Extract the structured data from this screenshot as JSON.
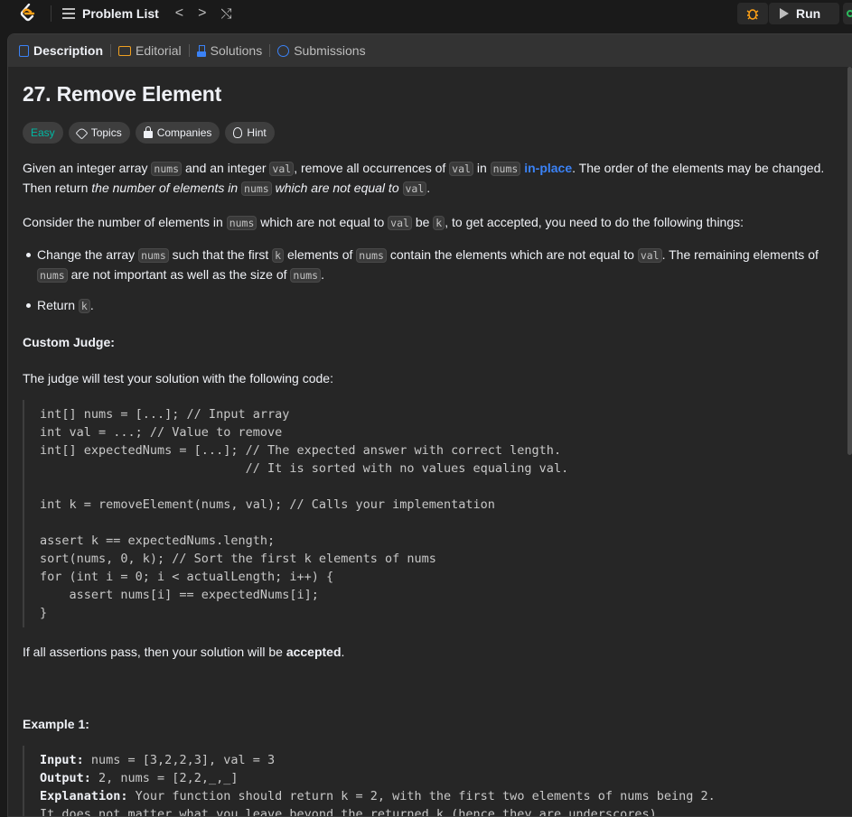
{
  "topbar": {
    "problem_list": "Problem List",
    "prev": "<",
    "next": ">",
    "shuffle": "⤭",
    "run": "Run"
  },
  "tabs": [
    {
      "label": "Description"
    },
    {
      "label": "Editorial"
    },
    {
      "label": "Solutions"
    },
    {
      "label": "Submissions"
    }
  ],
  "problem": {
    "title": "27. Remove Element",
    "badges": {
      "difficulty": "Easy",
      "topics": "Topics",
      "companies": "Companies",
      "hint": "Hint"
    },
    "p1": {
      "a": "Given an integer array ",
      "c1": "nums",
      "b": " and an integer ",
      "c2": "val",
      "c": ", remove all occurrences of ",
      "c3": "val",
      "d": " in ",
      "c4": "nums",
      "e": " ",
      "inplace": "in-place",
      "f": ". The order of the elements may be changed. Then return ",
      "g": "the number of elements in ",
      "c5": "nums",
      "h": " which are not equal to ",
      "c6": "val",
      "i": "."
    },
    "p2": {
      "a": "Consider the number of elements in ",
      "c1": "nums",
      "b": " which are not equal to ",
      "c2": "val",
      "c": " be ",
      "c3": "k",
      "d": ", to get accepted, you need to do the following things:"
    },
    "li1": {
      "a": "Change the array ",
      "c1": "nums",
      "b": " such that the first ",
      "c2": "k",
      "c": " elements of ",
      "c3": "nums",
      "d": " contain the elements which are not equal to ",
      "c4": "val",
      "e": ". The remaining elements of ",
      "c5": "nums",
      "f": " are not important as well as the size of ",
      "c6": "nums",
      "g": "."
    },
    "li2": {
      "a": "Return ",
      "c1": "k",
      "b": "."
    },
    "custom_judge": "Custom Judge:",
    "judge_text": "The judge will test your solution with the following code:",
    "code": "int[] nums = [...]; // Input array\nint val = ...; // Value to remove\nint[] expectedNums = [...]; // The expected answer with correct length.\n                            // It is sorted with no values equaling val.\n\nint k = removeElement(nums, val); // Calls your implementation\n\nassert k == expectedNums.length;\nsort(nums, 0, k); // Sort the first k elements of nums\nfor (int i = 0; i < actualLength; i++) {\n    assert nums[i] == expectedNums[i];\n}",
    "accept": {
      "a": "If all assertions pass, then your solution will be ",
      "b": "accepted",
      "c": "."
    },
    "example1": {
      "heading": "Example 1:",
      "input_label": "Input:",
      "input": " nums = [3,2,2,3], val = 3",
      "output_label": "Output:",
      "output": " 2, nums = [2,2,_,_]",
      "explanation_label": "Explanation:",
      "explanation": " Your function should return k = 2, with the first two elements of nums being 2.\nIt does not matter what you leave beyond the returned k (hence they are underscores)."
    }
  }
}
